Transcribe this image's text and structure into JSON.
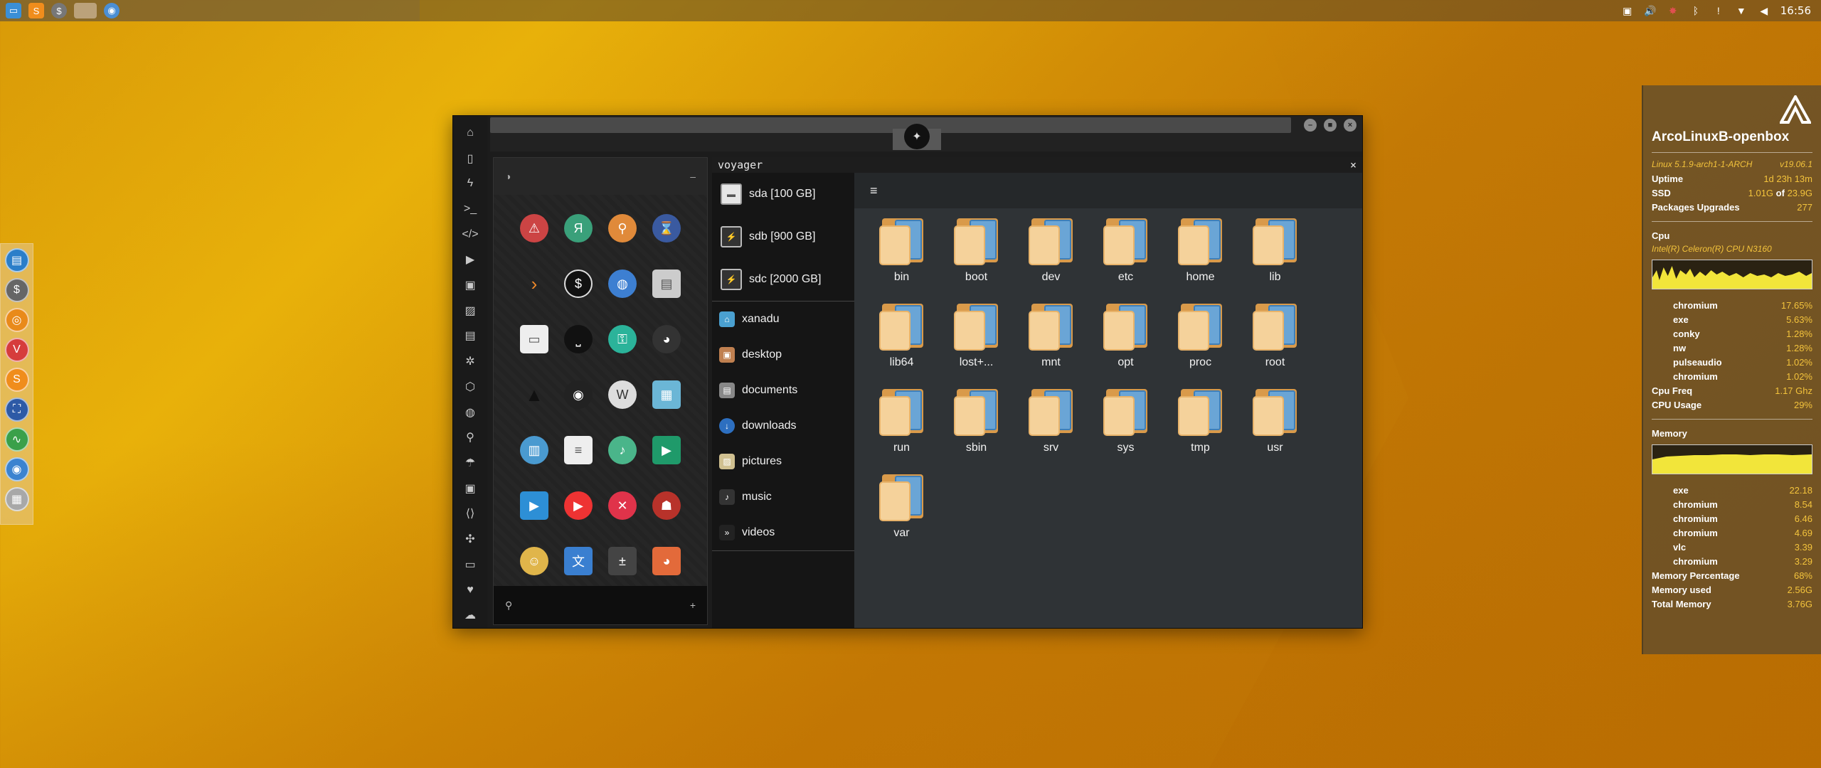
{
  "taskbar": {
    "left_icons": [
      "files-icon",
      "sublime-icon",
      "money-icon",
      "workspace-icon",
      "chromium-icon"
    ],
    "clock": "16:56"
  },
  "dock": {
    "items": [
      "file-manager-icon",
      "money-icon",
      "blender-icon",
      "vivaldi-icon",
      "sublime-icon",
      "screenshot-icon",
      "monitor-icon",
      "chromium-icon",
      "network-icon"
    ]
  },
  "window": {
    "vertical_icons": [
      "home-icon",
      "document-icon",
      "bolt-icon",
      "terminal-icon",
      "code-icon",
      "play-icon",
      "media-icon",
      "image-icon",
      "id-icon",
      "gear-icon",
      "empire-icon",
      "globe-icon",
      "search-icon",
      "umbrella-icon",
      "contact-icon",
      "link-icon",
      "fullscreen-icon",
      "youtube-icon",
      "heart-icon",
      "cloud-icon"
    ]
  },
  "file_manager": {
    "title": "voyager",
    "close": "×",
    "drives": [
      {
        "label": "sda [100 GB]"
      },
      {
        "label": "sdb [900 GB]"
      },
      {
        "label": "sdc [2000 GB]"
      }
    ],
    "places": [
      {
        "label": "xanadu"
      },
      {
        "label": "desktop"
      },
      {
        "label": "documents"
      },
      {
        "label": "downloads"
      },
      {
        "label": "pictures"
      },
      {
        "label": "music"
      },
      {
        "label": "videos"
      }
    ],
    "folders": [
      "bin",
      "boot",
      "dev",
      "etc",
      "home",
      "lib",
      "lib64",
      "lost+...",
      "mnt",
      "opt",
      "proc",
      "root",
      "run",
      "sbin",
      "srv",
      "sys",
      "tmp",
      "usr",
      "var"
    ]
  },
  "conky": {
    "title": "ArcoLinuxB-openbox",
    "kernel": "Linux 5.1.9-arch1-1-ARCH",
    "version": "v19.06.1",
    "uptime_label": "Uptime",
    "uptime_value": "1d 23h 13m",
    "ssd_label": "SSD",
    "ssd_used": "1.01G",
    "ssd_of": "of",
    "ssd_total": "23.9G",
    "packages_label": "Packages Upgrades",
    "packages_value": "277",
    "cpu_label": "Cpu",
    "cpu_model": "Intel(R) Celeron(R) CPU  N3160",
    "cpu_procs": [
      {
        "name": "chromium",
        "value": "17.65%"
      },
      {
        "name": "exe",
        "value": "5.63%"
      },
      {
        "name": "conky",
        "value": "1.28%"
      },
      {
        "name": "nw",
        "value": "1.28%"
      },
      {
        "name": "pulseaudio",
        "value": "1.02%"
      },
      {
        "name": "chromium",
        "value": "1.02%"
      }
    ],
    "cpu_freq_label": "Cpu Freq",
    "cpu_freq_value": "1.17 Ghz",
    "cpu_usage_label": "CPU Usage",
    "cpu_usage_value": "29%",
    "memory_label": "Memory",
    "mem_procs": [
      {
        "name": "exe",
        "value": "22.18"
      },
      {
        "name": "chromium",
        "value": "8.54"
      },
      {
        "name": "chromium",
        "value": "6.46"
      },
      {
        "name": "chromium",
        "value": "4.69"
      },
      {
        "name": "vlc",
        "value": "3.39"
      },
      {
        "name": "chromium",
        "value": "3.29"
      }
    ],
    "mem_pct_label": "Memory Percentage",
    "mem_pct_value": "68%",
    "mem_used_label": "Memory used",
    "mem_used_value": "2.56G",
    "mem_total_label": "Total Memory",
    "mem_total_value": "3.76G"
  },
  "colors": {
    "accent": "#f3c33c",
    "folder_front": "#f5d29b",
    "folder_back": "#d99a4a",
    "folder_doc": "#6aa5d6"
  }
}
